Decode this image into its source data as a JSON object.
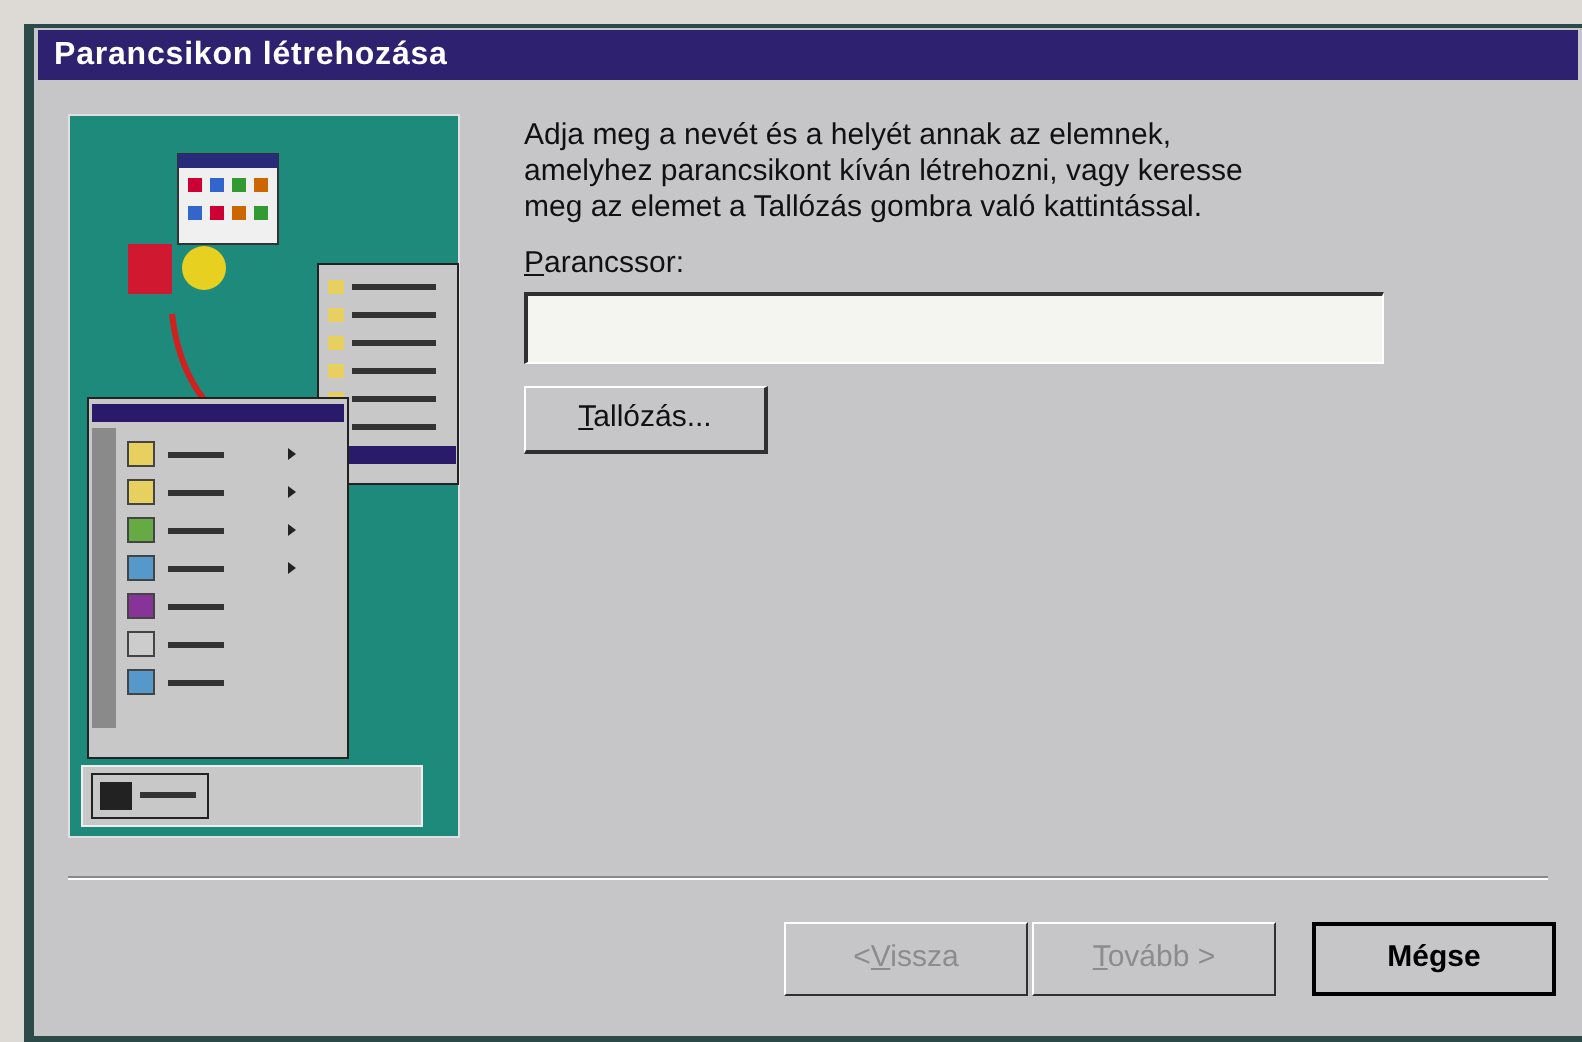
{
  "window": {
    "title": "Parancsikon létrehozása"
  },
  "instructions": "Adja meg a nevét és a helyét annak az elemnek, amelyhez parancsikont kíván létrehozni, vagy keresse meg az elemet a Tallózás gombra való kattintással.",
  "command_line": {
    "label": {
      "key": "P",
      "after": "arancssor:"
    }
  },
  "browse_button": {
    "label": {
      "key": "T",
      "after": "allózás..."
    }
  },
  "buttons": [
    {
      "label": {
        "before": "<",
        "key": "V",
        "after": "issza"
      },
      "disabled": true,
      "default": false
    },
    {
      "label": {
        "key": "T",
        "after": "ovább >"
      },
      "disabled": true,
      "default": false
    },
    {
      "label": {
        "before": "Mégse"
      },
      "disabled": false,
      "default": true
    }
  ]
}
